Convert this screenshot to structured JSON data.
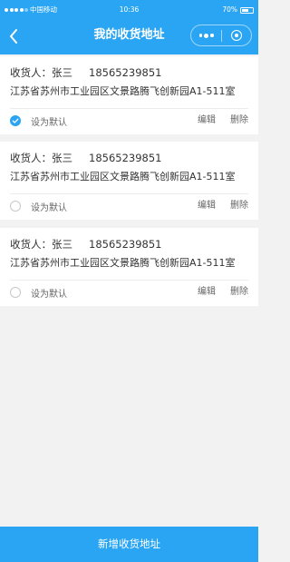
{
  "status_bar": {
    "carrier": "中国移动",
    "time": "10:36",
    "battery": "70%",
    "battery_level": 0.7
  },
  "nav": {
    "title": "我的收货地址",
    "back_icon": "chevron-left-icon",
    "more_icon": "more-dots-icon",
    "close_icon": "target-circle-icon"
  },
  "address_list": [
    {
      "label": "收货人：张三",
      "phone": "18565239851",
      "address": "江苏省苏州市工业园区文景路腾飞创新园A1-511室",
      "default_label": "设为默认",
      "is_default": true,
      "edit_label": "编辑",
      "delete_label": "删除"
    },
    {
      "label": "收货人：张三",
      "phone": "18565239851",
      "address": "江苏省苏州市工业园区文景路腾飞创新园A1-511室",
      "default_label": "设为默认",
      "is_default": false,
      "edit_label": "编辑",
      "delete_label": "删除"
    },
    {
      "label": "收货人：张三",
      "phone": "18565239851",
      "address": "江苏省苏州市工业园区文景路腾飞创新园A1-511室",
      "default_label": "设为默认",
      "is_default": false,
      "edit_label": "编辑",
      "delete_label": "删除"
    }
  ],
  "footer": {
    "add_button_label": "新增收货地址"
  },
  "colors": {
    "primary": "#2aa5f3",
    "background": "#f2f2f2"
  }
}
